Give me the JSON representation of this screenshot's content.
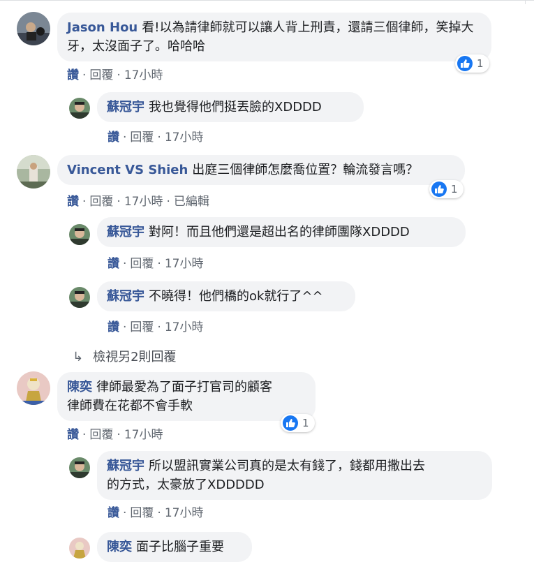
{
  "comments": {
    "c1": {
      "author": "Jason Hou",
      "text": "看!以為請律師就可以讓人背上刑責，還請三個律師，笑掉大牙，太沒面子了。哈哈哈",
      "like": "讚",
      "reply": "回覆",
      "time": "17小時",
      "reactions": "1"
    },
    "r1": {
      "author": "蘇冠宇",
      "text": "我也覺得他們挺丟臉的XDDDD",
      "like": "讚",
      "reply": "回覆",
      "time": "17小時"
    },
    "c2": {
      "author": "Vincent VS Shieh",
      "text": "出庭三個律師怎麼喬位置？輪流發言嗎？",
      "like": "讚",
      "reply": "回覆",
      "time": "17小時",
      "edited": "已編輯",
      "reactions": "1"
    },
    "r2": {
      "author": "蘇冠宇",
      "text": "對阿！而且他們還是超出名的律師團隊XDDDD",
      "like": "讚",
      "reply": "回覆",
      "time": "17小時"
    },
    "r3": {
      "author": "蘇冠宇",
      "text": "不曉得！他們橋的ok就行了^^",
      "like": "讚",
      "reply": "回覆",
      "time": "17小時"
    },
    "more_replies": "檢視另2則回覆",
    "c3": {
      "author": "陳奕",
      "text": "律師最愛為了面子打官司的顧客律師費在花都不會手軟",
      "line1": "律師最愛為了面子打官司的顧客",
      "line2": "律師費在花都不會手軟",
      "like": "讚",
      "reply": "回覆",
      "time": "17小時",
      "reactions": "1"
    },
    "r4": {
      "author": "蘇冠宇",
      "text": "所以盟訊實業公司真的是太有錢了，錢都用撒出去的方式，太豪放了XDDDDD",
      "line1": "所以盟訊實業公司真的是太有錢了，錢都用撒出去",
      "line2": "的方式，太豪放了XDDDDD",
      "like": "讚",
      "reply": "回覆",
      "time": "17小時"
    },
    "r5": {
      "author": "陳奕",
      "text": "面子比腦子重要"
    }
  },
  "separator": "·",
  "colors": {
    "link": "#385898",
    "bubble": "#f2f3f5",
    "meta": "#606770",
    "like_blue": "#1877f2"
  },
  "icons": {
    "reaction": "thumbs-up-icon",
    "reply_arrow": "reply-arrow-icon"
  }
}
